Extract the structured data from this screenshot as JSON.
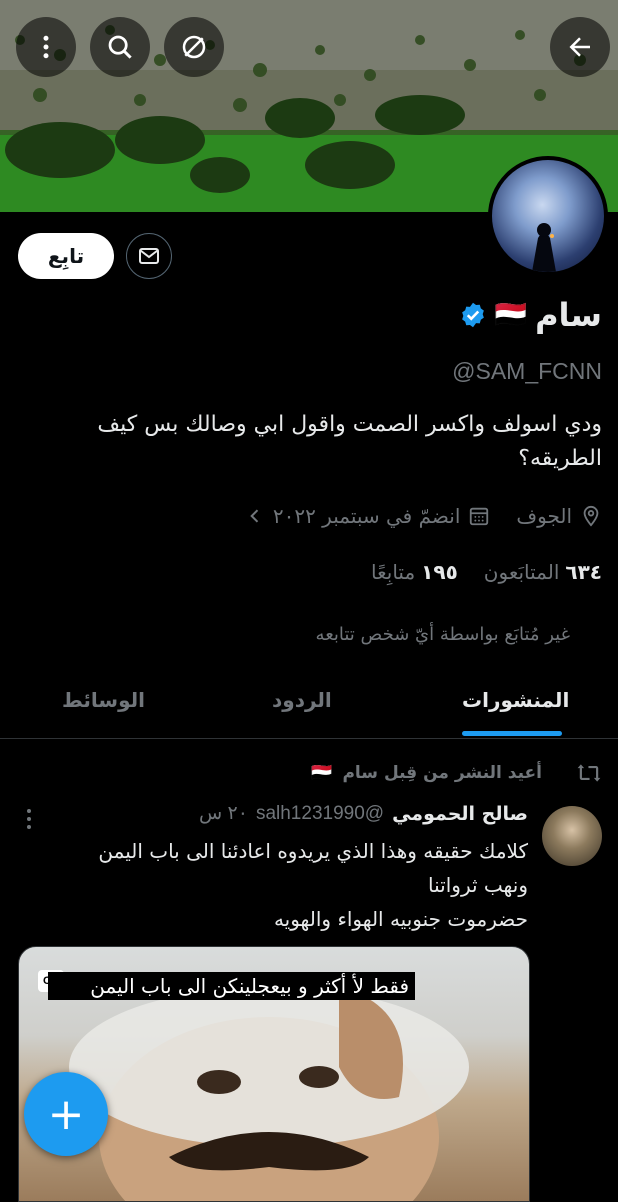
{
  "header": {
    "back_icon": "arrow-left-icon",
    "actions": [
      "translate-off-icon",
      "search-icon",
      "more-vertical-icon"
    ]
  },
  "profile": {
    "follow_label": "تابِع",
    "name": "سام",
    "flag": "🇾🇪",
    "verified_color": "#1d9bf0",
    "handle": "@SAM_FCNN",
    "bio": "ودي اسولف واكسر الصمت واقول ابي وصالك بس كيف الطريقه؟",
    "location": "الجوف",
    "joined": "انضمّ في سبتمبر ٢٠٢٢",
    "followers_count": "٦٣٤",
    "followers_label": "المتابَعون",
    "following_count": "١٩٥",
    "following_label": "متابِعًا",
    "not_followed_note": "غير مُتابَع بواسطة أيّ شخص تتابعه"
  },
  "tabs": [
    {
      "label": "المنشورات",
      "active": true
    },
    {
      "label": "الردود",
      "active": false
    },
    {
      "label": "الوسائط",
      "active": false
    }
  ],
  "post": {
    "repost_label": "أعيد النشر من قِبل سام",
    "author_name": "صالح الحمومي",
    "author_handle": "@salh1231990",
    "time": "٢٠ س",
    "text_line1": "كلامك حقيقه وهذا الذي يريدوه اعادئنا الى باب اليمن",
    "text_line2": "ونهب ثرواتنا",
    "text_line3": "حضرموت جنوبيه الهواء والهويه",
    "video_caption": "فقط لأ أكثر و بيعجلينكن الى باب اليمن",
    "cc_label": "CC"
  },
  "fab_label": "+",
  "colors": {
    "accent": "#1d9bf0",
    "background": "#000000",
    "muted": "#71767b"
  }
}
